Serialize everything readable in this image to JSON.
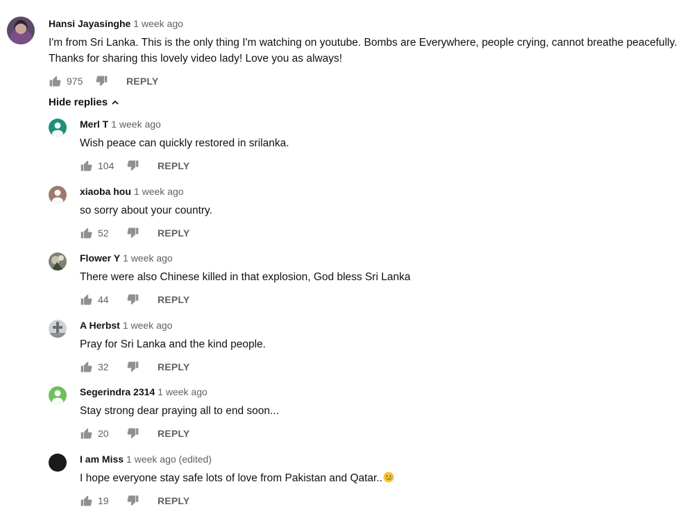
{
  "main_comment": {
    "author": "Hansi Jayasinghe",
    "time": "1 week ago",
    "text_line1": "I'm from Sri Lanka. This is the only thing I'm watching on youtube. Bombs are Everywhere, people crying, cannot breathe peacefully.",
    "text_line2": "Thanks for sharing this lovely video lady! Love you as always!",
    "likes": "975",
    "reply_label": "REPLY"
  },
  "hide_replies_label": "Hide replies",
  "replies": [
    {
      "author": "Merl T",
      "time": "1 week ago",
      "text": "Wish peace can quickly restored in srilanka.",
      "likes": "104",
      "reply_label": "REPLY",
      "avatar_color": "#1f8f7a"
    },
    {
      "author": "xiaoba hou",
      "time": "1 week ago",
      "text": "so sorry about your country.",
      "likes": "52",
      "reply_label": "REPLY",
      "avatar_color": "#9c7a6e"
    },
    {
      "author": "Flower Y",
      "time": "1 week ago",
      "text": "There were also Chinese killed in that explosion, God bless Sri Lanka",
      "likes": "44",
      "reply_label": "REPLY",
      "avatar_color": "#5f6b5a"
    },
    {
      "author": "A Herbst",
      "time": "1 week ago",
      "text": "Pray for Sri Lanka and the kind people.",
      "likes": "32",
      "reply_label": "REPLY",
      "avatar_color": "#8a8f93"
    },
    {
      "author": "Segerindra 2314",
      "time": "1 week ago",
      "text": "Stay strong dear praying all to end soon...",
      "likes": "20",
      "reply_label": "REPLY",
      "avatar_color": "#6fbf5a"
    },
    {
      "author": "I am Miss",
      "time": "1 week ago (edited)",
      "text": "I hope everyone stay safe lots of love from Pakistan and Qatar..",
      "likes": "19",
      "reply_label": "REPLY",
      "avatar_color": "#1a1a1a"
    }
  ],
  "colors": {
    "text": "#111111",
    "meta": "#606060",
    "icon": "#909090"
  },
  "icons": {
    "like": "thumbs-up-icon",
    "dislike": "thumbs-down-icon",
    "chevron": "chevron-up-icon",
    "emoji": "sad-face-emoji"
  }
}
